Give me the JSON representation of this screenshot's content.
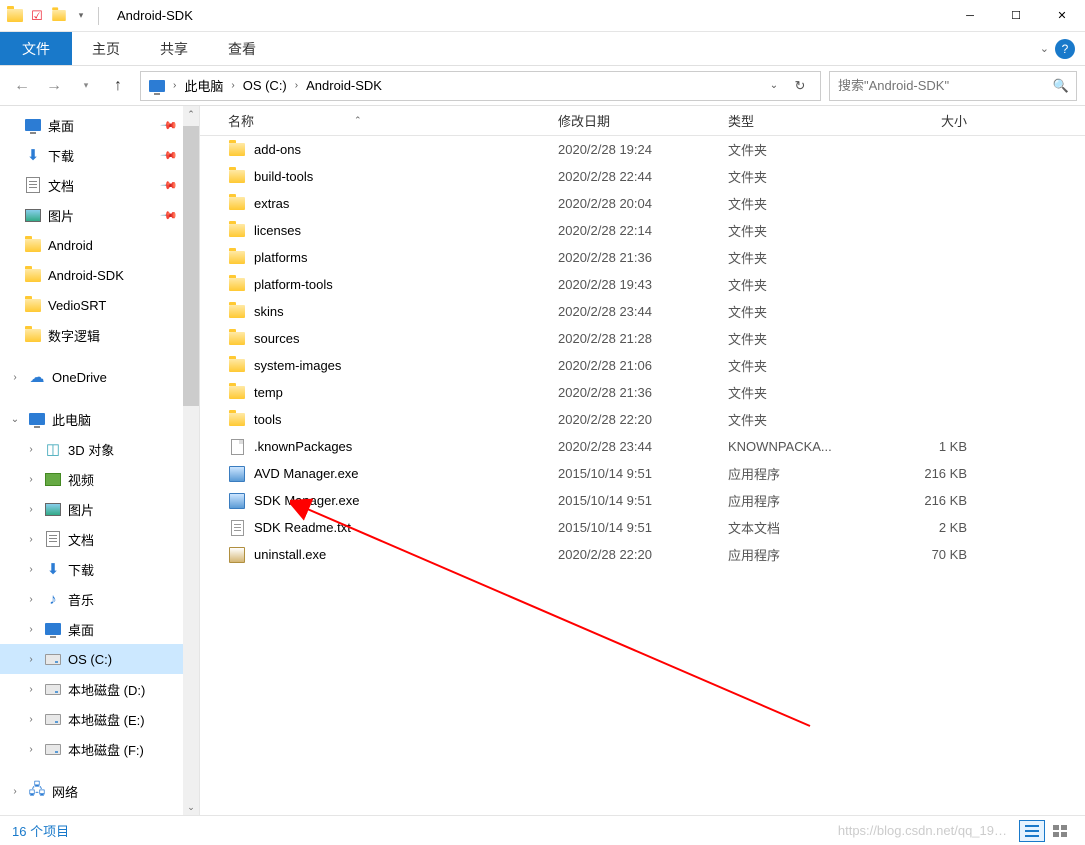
{
  "window": {
    "title": "Android-SDK"
  },
  "ribbon": {
    "file": "文件",
    "tabs": [
      "主页",
      "共享",
      "查看"
    ]
  },
  "breadcrumb": {
    "items": [
      "此电脑",
      "OS (C:)",
      "Android-SDK"
    ]
  },
  "search": {
    "placeholder": "搜索\"Android-SDK\""
  },
  "sidebar": {
    "quick": [
      {
        "label": "桌面",
        "icon": "desktop",
        "pinned": true
      },
      {
        "label": "下载",
        "icon": "download",
        "pinned": true
      },
      {
        "label": "文档",
        "icon": "doc",
        "pinned": true
      },
      {
        "label": "图片",
        "icon": "pic",
        "pinned": true
      },
      {
        "label": "Android",
        "icon": "folder",
        "pinned": false
      },
      {
        "label": "Android-SDK",
        "icon": "folder",
        "pinned": false
      },
      {
        "label": "VedioSRT",
        "icon": "folder",
        "pinned": false
      },
      {
        "label": "数字逻辑",
        "icon": "folder",
        "pinned": false
      }
    ],
    "onedrive": "OneDrive",
    "thispc": "此电脑",
    "thispc_items": [
      {
        "label": "3D 对象",
        "icon": "3d"
      },
      {
        "label": "视频",
        "icon": "video"
      },
      {
        "label": "图片",
        "icon": "pic"
      },
      {
        "label": "文档",
        "icon": "doc"
      },
      {
        "label": "下载",
        "icon": "download"
      },
      {
        "label": "音乐",
        "icon": "music"
      },
      {
        "label": "桌面",
        "icon": "desktop"
      },
      {
        "label": "OS (C:)",
        "icon": "drive",
        "selected": true
      },
      {
        "label": "本地磁盘 (D:)",
        "icon": "drive"
      },
      {
        "label": "本地磁盘 (E:)",
        "icon": "drive"
      },
      {
        "label": "本地磁盘 (F:)",
        "icon": "drive"
      }
    ],
    "network": "网络"
  },
  "columns": {
    "name": "名称",
    "date": "修改日期",
    "type": "类型",
    "size": "大小"
  },
  "files": [
    {
      "name": "add-ons",
      "date": "2020/2/28 19:24",
      "type": "文件夹",
      "size": "",
      "icon": "folder"
    },
    {
      "name": "build-tools",
      "date": "2020/2/28 22:44",
      "type": "文件夹",
      "size": "",
      "icon": "folder"
    },
    {
      "name": "extras",
      "date": "2020/2/28 20:04",
      "type": "文件夹",
      "size": "",
      "icon": "folder"
    },
    {
      "name": "licenses",
      "date": "2020/2/28 22:14",
      "type": "文件夹",
      "size": "",
      "icon": "folder"
    },
    {
      "name": "platforms",
      "date": "2020/2/28 21:36",
      "type": "文件夹",
      "size": "",
      "icon": "folder"
    },
    {
      "name": "platform-tools",
      "date": "2020/2/28 19:43",
      "type": "文件夹",
      "size": "",
      "icon": "folder"
    },
    {
      "name": "skins",
      "date": "2020/2/28 23:44",
      "type": "文件夹",
      "size": "",
      "icon": "folder"
    },
    {
      "name": "sources",
      "date": "2020/2/28 21:28",
      "type": "文件夹",
      "size": "",
      "icon": "folder"
    },
    {
      "name": "system-images",
      "date": "2020/2/28 21:06",
      "type": "文件夹",
      "size": "",
      "icon": "folder"
    },
    {
      "name": "temp",
      "date": "2020/2/28 21:36",
      "type": "文件夹",
      "size": "",
      "icon": "folder"
    },
    {
      "name": "tools",
      "date": "2020/2/28 22:20",
      "type": "文件夹",
      "size": "",
      "icon": "folder"
    },
    {
      "name": ".knownPackages",
      "date": "2020/2/28 23:44",
      "type": "KNOWNPACKA...",
      "size": "1 KB",
      "icon": "file"
    },
    {
      "name": "AVD Manager.exe",
      "date": "2015/10/14 9:51",
      "type": "应用程序",
      "size": "216 KB",
      "icon": "exe"
    },
    {
      "name": "SDK Manager.exe",
      "date": "2015/10/14 9:51",
      "type": "应用程序",
      "size": "216 KB",
      "icon": "exe"
    },
    {
      "name": "SDK Readme.txt",
      "date": "2015/10/14 9:51",
      "type": "文本文档",
      "size": "2 KB",
      "icon": "txt"
    },
    {
      "name": "uninstall.exe",
      "date": "2020/2/28 22:20",
      "type": "应用程序",
      "size": "70 KB",
      "icon": "uninstall"
    }
  ],
  "status": {
    "count": "16 个项目",
    "watermark": "https://blog.csdn.net/qq_19…"
  }
}
